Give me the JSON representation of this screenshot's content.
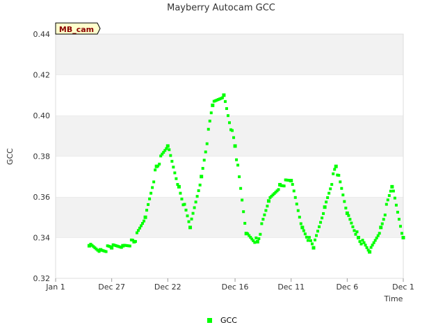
{
  "chart_data": {
    "type": "scatter",
    "title": "Mayberry Autocam GCC",
    "xlabel": "Time",
    "ylabel": "GCC",
    "site_badge": "MB_cam",
    "x_ticks": [
      "Jan 1",
      "Dec 27",
      "Dec 22",
      "Dec 16",
      "Dec 11",
      "Dec 6",
      "Dec 1"
    ],
    "x_axis_note": "dates decrease left to right; Jan 1 at left edge, Dec 1 at right edge",
    "ylim": [
      0.32,
      0.44
    ],
    "y_ticks": [
      "0.32",
      "0.34",
      "0.36",
      "0.38",
      "0.40",
      "0.42",
      "0.44"
    ],
    "grid": "alternating horizontal bands",
    "band_color": "#f2f2f2",
    "marker_color": "#00ff00",
    "legend_position": "bottom-center",
    "series": [
      {
        "name": "GCC",
        "color": "#00ff00",
        "points": [
          [
            "Dec 29",
            0.336
          ],
          [
            "Dec 28",
            0.334
          ],
          [
            "Dec 27",
            0.335
          ],
          [
            "Dec 26",
            0.336
          ],
          [
            "Dec 25",
            0.338
          ],
          [
            "Dec 24",
            0.35
          ],
          [
            "Dec 23",
            0.375
          ],
          [
            "Dec 22",
            0.385
          ],
          [
            "Dec 21",
            0.365
          ],
          [
            "Dec 20",
            0.345
          ],
          [
            "Dec 19",
            0.37
          ],
          [
            "Dec 18",
            0.405
          ],
          [
            "Dec 17",
            0.41
          ],
          [
            "Dec 16",
            0.385
          ],
          [
            "Dec 15",
            0.342
          ],
          [
            "Dec 14",
            0.338
          ],
          [
            "Dec 13",
            0.358
          ],
          [
            "Dec 12",
            0.366
          ],
          [
            "Dec 11",
            0.368
          ],
          [
            "Dec 10",
            0.345
          ],
          [
            "Dec 9",
            0.335
          ],
          [
            "Dec 8",
            0.355
          ],
          [
            "Dec 7",
            0.375
          ],
          [
            "Dec 6",
            0.352
          ],
          [
            "Dec 5",
            0.34
          ],
          [
            "Dec 4",
            0.333
          ],
          [
            "Dec 3",
            0.345
          ],
          [
            "Dec 2",
            0.365
          ],
          [
            "Dec 1",
            0.34
          ]
        ]
      }
    ]
  }
}
